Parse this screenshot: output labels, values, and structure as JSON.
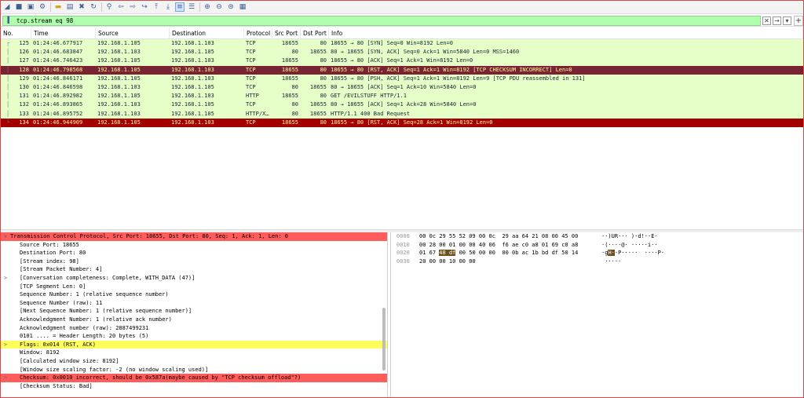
{
  "toolbar": {
    "icons": [
      "shark-fin-icon",
      "stop-icon",
      "restart-icon",
      "options-gear-icon",
      "open-folder-icon",
      "save-icon",
      "close-file-icon",
      "reload-icon",
      "find-icon",
      "back-arrow-icon",
      "forward-arrow-icon",
      "go-to-packet-icon",
      "first-packet-icon",
      "last-packet-icon",
      "autoscroll-icon",
      "colorize-icon",
      "zoom-in-icon",
      "zoom-out-icon",
      "zoom-normal-icon",
      "resize-columns-icon"
    ]
  },
  "filter": {
    "value": "tcp.stream eq 98",
    "bookmark_icon": "bookmark-icon",
    "clear_icon": "clear-x-icon",
    "apply_icon": "apply-arrow-icon",
    "dropdown_icon": "chevron-down-icon",
    "add_icon": "plus-icon",
    "add_label": "+"
  },
  "packet_list": {
    "columns": [
      "No.",
      "Time",
      "Source",
      "Destination",
      "Protocol",
      "Src Port",
      "Dst Port",
      "Info"
    ],
    "rows": [
      {
        "no": "125",
        "time": "01:24:46.677917",
        "src": "192.168.1.105",
        "dst": "192.168.1.103",
        "proto": "TCP",
        "sport": "18655",
        "dport": "80",
        "info": "18655 → 80 [SYN] Seq=0 Win=8192 Len=0"
      },
      {
        "no": "126",
        "time": "01:24:46.683847",
        "src": "192.168.1.103",
        "dst": "192.168.1.105",
        "proto": "TCP",
        "sport": "80",
        "dport": "18655",
        "info": "80 → 18655 [SYN, ACK] Seq=0 Ack=1 Win=5840 Len=0 MSS=1460"
      },
      {
        "no": "127",
        "time": "01:24:46.746423",
        "src": "192.168.1.105",
        "dst": "192.168.1.103",
        "proto": "TCP",
        "sport": "18655",
        "dport": "80",
        "info": "18655 → 80 [ACK] Seq=1 Ack=1 Win=8192 Len=0"
      },
      {
        "no": "128",
        "time": "01:24:46.798568",
        "src": "192.168.1.105",
        "dst": "192.168.1.103",
        "proto": "TCP",
        "sport": "18655",
        "dport": "80",
        "info": "18655 → 80 [RST, ACK] Seq=1 Ack=1 Win=8192 [TCP CHECKSUM INCORRECT] Len=0"
      },
      {
        "no": "129",
        "time": "01:24:46.846171",
        "src": "192.168.1.105",
        "dst": "192.168.1.103",
        "proto": "TCP",
        "sport": "18655",
        "dport": "80",
        "info": "18655 → 80 [PSH, ACK] Seq=1 Ack=1 Win=8192 Len=9 [TCP PDU reassembled in 131]"
      },
      {
        "no": "130",
        "time": "01:24:46.846598",
        "src": "192.168.1.103",
        "dst": "192.168.1.105",
        "proto": "TCP",
        "sport": "80",
        "dport": "18655",
        "info": "80 → 18655 [ACK] Seq=1 Ack=10 Win=5840 Len=0"
      },
      {
        "no": "131",
        "time": "01:24:46.892982",
        "src": "192.168.1.105",
        "dst": "192.168.1.103",
        "proto": "HTTP",
        "sport": "18655",
        "dport": "80",
        "info": "GET /EVILSTUFF HTTP/1.1"
      },
      {
        "no": "132",
        "time": "01:24:46.893865",
        "src": "192.168.1.103",
        "dst": "192.168.1.105",
        "proto": "TCP",
        "sport": "80",
        "dport": "18655",
        "info": "80 → 18655 [ACK] Seq=1 Ack=28 Win=5840 Len=0"
      },
      {
        "no": "133",
        "time": "01:24:46.895752",
        "src": "192.168.1.103",
        "dst": "192.168.1.105",
        "proto": "HTTP/X…",
        "sport": "80",
        "dport": "18655",
        "info": "HTTP/1.1 400 Bad Request"
      },
      {
        "no": "134",
        "time": "01:24:46.944909",
        "src": "192.168.1.105",
        "dst": "192.168.1.103",
        "proto": "TCP",
        "sport": "18655",
        "dport": "80",
        "info": "18655 → 80 [RST, ACK] Seq=28 Ack=1 Win=8192 Len=0"
      }
    ]
  },
  "details": {
    "rows": [
      {
        "arrow": "∨",
        "text": "Transmission Control Protocol, Src Port: 18655, Dst Port: 80, Seq: 1, Ack: 1, Len: 0"
      },
      {
        "arrow": "",
        "text": "Source Port: 18655"
      },
      {
        "arrow": "",
        "text": "Destination Port: 80"
      },
      {
        "arrow": "",
        "text": "[Stream index: 98]"
      },
      {
        "arrow": "",
        "text": "[Stream Packet Number: 4]"
      },
      {
        "arrow": ">",
        "text": "[Conversation completeness: Complete, WITH_DATA (47)]"
      },
      {
        "arrow": "",
        "text": "[TCP Segment Len: 0]"
      },
      {
        "arrow": "",
        "text": "Sequence Number: 1    (relative sequence number)"
      },
      {
        "arrow": "",
        "text": "Sequence Number (raw): 11"
      },
      {
        "arrow": "",
        "text": "[Next Sequence Number: 1    (relative sequence number)]"
      },
      {
        "arrow": "",
        "text": "Acknowledgment Number: 1    (relative ack number)"
      },
      {
        "arrow": "",
        "text": "Acknowledgment number (raw): 2887499231"
      },
      {
        "arrow": "",
        "text": "0101 .... = Header Length: 20 bytes (5)"
      },
      {
        "arrow": ">",
        "text": "Flags: 0x014 (RST, ACK)"
      },
      {
        "arrow": "",
        "text": "Window: 8192"
      },
      {
        "arrow": "",
        "text": "[Calculated window size: 8192]"
      },
      {
        "arrow": "",
        "text": "[Window size scaling factor: -2 (no window scaling used)]"
      },
      {
        "arrow": ">",
        "text": "Checksum: 0x0010 incorrect, should be 0x587a(maybe caused by \"TCP checksum offload\"?)"
      },
      {
        "arrow": "",
        "text": "[Checksum Status: Bad]"
      }
    ]
  },
  "bytes": {
    "rows": [
      {
        "offset": "0000",
        "hex_a": "00 0c 29 55 52 09 00 0c  29 aa 64 21 08 00 45 00",
        "hex_hl": "",
        "hex_b": "",
        "ascii_a": "··)UR··· )·d!··E·",
        "ascii_hl": "",
        "ascii_b": ""
      },
      {
        "offset": "0010",
        "hex_a": "00 28 00 01 00 00 40 06  f6 ae c0 a8 01 69 c0 a8",
        "hex_hl": "",
        "hex_b": "",
        "ascii_a": "·(····@· ·····i··",
        "ascii_hl": "",
        "ascii_b": ""
      },
      {
        "offset": "0020",
        "hex_a": "01 67 ",
        "hex_hl": "48 df",
        "hex_b": " 00 50 00 00  00 0b ac 1b bd df 50 14",
        "ascii_a": "·g",
        "ascii_hl": "H·",
        "ascii_b": "·P·····  ····P·"
      },
      {
        "offset": "0030",
        "hex_a": "20 00 00 10 00 00",
        "hex_hl": "",
        "hex_b": "",
        "ascii_a": " ·····",
        "ascii_hl": "",
        "ascii_b": ""
      }
    ]
  },
  "colors": {
    "tcp_row": "#e6ffc8",
    "selected_row": "#7a2332",
    "rst_row": "#a40000",
    "filter_valid": "#afffaf",
    "error_highlight": "#ff5c5c",
    "warn_highlight": "#ffff5c"
  }
}
